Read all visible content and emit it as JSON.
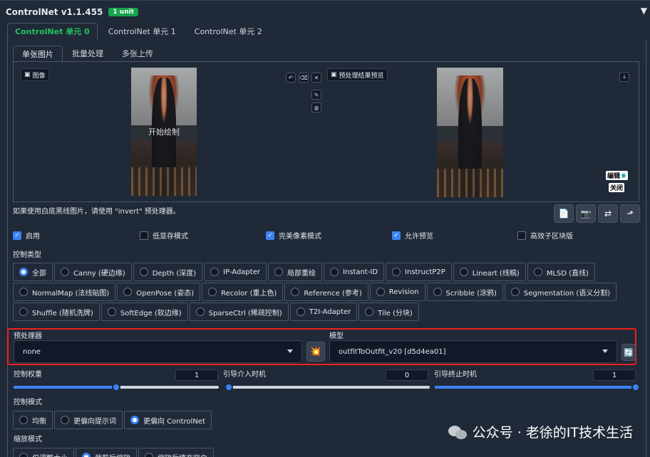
{
  "header": {
    "title": "ControlNet v1.1.455",
    "badge": "1 unit",
    "caret": "▼"
  },
  "unit_tabs": [
    "ControlNet 单元 0",
    "ControlNet 单元 1",
    "ControlNet 单元 2"
  ],
  "input_tabs": [
    "单张图片",
    "批量处理",
    "多张上传"
  ],
  "image_panel": {
    "image_label": "图像",
    "overlay_text": "开始绘制",
    "preview_label": "预处理结果预览",
    "edit_tag": "编辑",
    "close_tag": "关闭"
  },
  "hint": "如果使用白底黑线图片，请使用 \"invert\" 预处理器。",
  "checkboxes": {
    "enable": {
      "label": "启用",
      "checked": true
    },
    "low_vram": {
      "label": "低显存模式",
      "checked": false
    },
    "pixel_perfect": {
      "label": "完美像素模式",
      "checked": true
    },
    "allow_preview": {
      "label": "允许预览",
      "checked": true
    },
    "effective_region": {
      "label": "高效子区块版",
      "checked": false
    }
  },
  "control_type": {
    "label": "控制类型",
    "rows": [
      [
        "全部",
        "Canny (硬边缘)",
        "Depth (深度)",
        "IP-Adapter",
        "局部重绘",
        "Instant-ID",
        "InstructP2P",
        "Lineart (线稿)",
        "MLSD (直线)"
      ],
      [
        "NormalMap (法线贴图)",
        "OpenPose (姿态)",
        "Recolor (重上色)",
        "Reference (参考)",
        "Revision",
        "Scribble (涂鸦)",
        "Segmentation (语义分割)"
      ],
      [
        "Shuffle (随机洗牌)",
        "SoftEdge (软边缘)",
        "SparseCtrl (稀疏控制)",
        "T2I-Adapter",
        "Tile (分块)"
      ]
    ],
    "selected": "全部"
  },
  "preprocessor": {
    "label": "预处理器",
    "value": "none"
  },
  "model": {
    "label": "模型",
    "value": "outfitToOutfit_v20 [d5d4ea01]"
  },
  "sliders": {
    "weight": {
      "label": "控制权重",
      "value": "1",
      "fraction": 0.5
    },
    "start": {
      "label": "引导介入时机",
      "value": "0",
      "fraction": 0.0
    },
    "end": {
      "label": "引导终止时机",
      "value": "1",
      "fraction": 1.0
    }
  },
  "control_mode": {
    "label": "控制模式",
    "options": [
      "均衡",
      "更偏向提示词",
      "更偏向 ControlNet"
    ],
    "selected": "更偏向 ControlNet"
  },
  "resize_mode": {
    "label": "缩放模式",
    "options": [
      "仅调整大小",
      "裁剪后缩放",
      "缩放后填充空白"
    ],
    "selected": "裁剪后缩放"
  },
  "watermark": "公众号 · 老徐的IT技术生活",
  "colors": {
    "accent": "#3b82f6",
    "active_tab": "#22c55e",
    "badge": "#16a34a",
    "highlight": "#ef2020"
  }
}
